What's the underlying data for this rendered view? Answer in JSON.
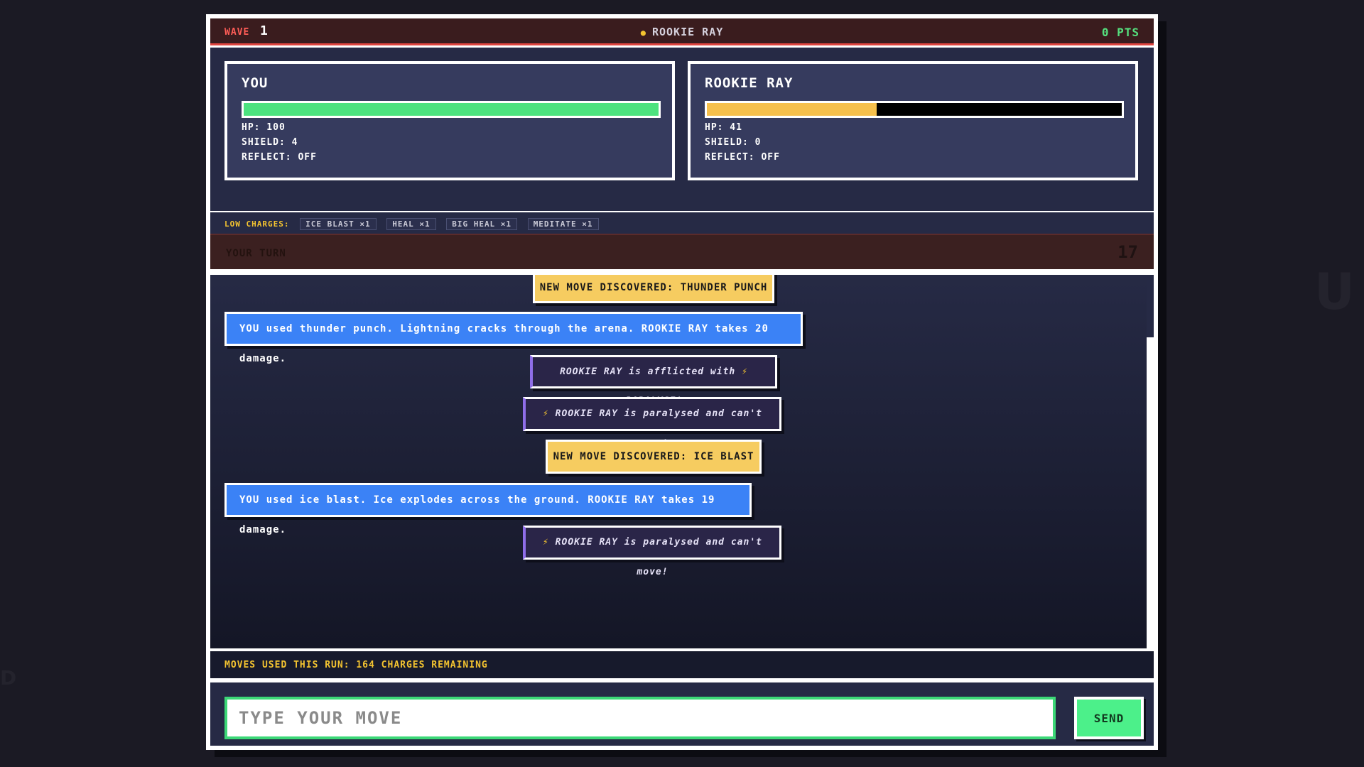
{
  "header": {
    "wave_label": "WAVE",
    "wave_number": "1",
    "opponent_title": "ROOKIE RAY",
    "points": "0 PTS"
  },
  "player": {
    "name": "YOU",
    "hp_fraction": 1.0,
    "hp_color": "#4ce27f",
    "hp": "HP: 100",
    "shield": "SHIELD: 4",
    "reflect": "REFLECT: OFF"
  },
  "enemy": {
    "name": "ROOKIE RAY",
    "hp_fraction": 0.41,
    "hp_color": "#f6c04d",
    "hp": "HP: 41",
    "shield": "SHIELD: 0",
    "reflect": "REFLECT: OFF"
  },
  "charges": {
    "label": "LOW CHARGES:",
    "items": [
      "ICE BLAST ×1",
      "HEAL ×1",
      "BIG HEAL ×1",
      "MEDITATE ×1"
    ]
  },
  "turn": {
    "label": "YOUR TURN",
    "timer": "17"
  },
  "log": {
    "messages": [
      {
        "type": "discover",
        "text": "NEW MOVE DISCOVERED: THUNDER PUNCH"
      },
      {
        "type": "action",
        "text": "YOU used thunder punch. Lightning cracks through the arena. ROOKIE RAY takes 20 damage."
      },
      {
        "type": "status",
        "text": "ROOKIE RAY is afflicted with ⚡ PARALYSE!"
      },
      {
        "type": "status",
        "text": "⚡ ROOKIE RAY is paralysed and can't move!"
      },
      {
        "type": "discover",
        "text": "NEW MOVE DISCOVERED: ICE BLAST"
      },
      {
        "type": "action",
        "text": "YOU used ice blast. Ice explodes across the ground. ROOKIE RAY takes 19 damage."
      },
      {
        "type": "status",
        "text": "⚡ ROOKIE RAY is paralysed and can't move!"
      }
    ]
  },
  "footer": {
    "info": "MOVES USED THIS RUN: 164 CHARGES REMAINING"
  },
  "input": {
    "placeholder": "TYPE YOUR MOVE",
    "send_label": "SEND"
  },
  "background": {
    "glyph_right": "U",
    "glyph_left": "D"
  }
}
